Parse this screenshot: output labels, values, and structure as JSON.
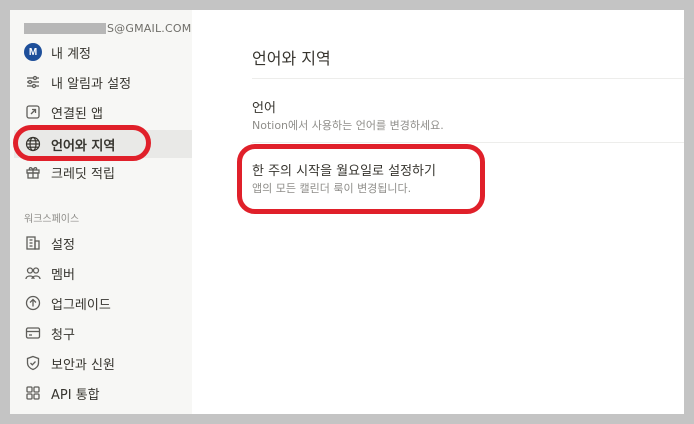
{
  "account": {
    "email_visible": "S@GMAIL.COM"
  },
  "sidebar": {
    "account_items": [
      {
        "label": "내 계정",
        "icon": "avatar",
        "avatar_letter": "M"
      },
      {
        "label": "내 알림과 설정",
        "icon": "sliders-icon"
      },
      {
        "label": "연결된 앱",
        "icon": "external-link-icon"
      },
      {
        "label": "언어와 지역",
        "icon": "globe-icon",
        "active": true
      },
      {
        "label": "크레딧 적립",
        "icon": "gift-icon"
      }
    ],
    "workspace_label": "워크스페이스",
    "workspace_items": [
      {
        "label": "설정",
        "icon": "building-icon"
      },
      {
        "label": "멤버",
        "icon": "members-icon"
      },
      {
        "label": "업그레이드",
        "icon": "upgrade-icon"
      },
      {
        "label": "청구",
        "icon": "credit-card-icon"
      },
      {
        "label": "보안과 신원",
        "icon": "shield-icon"
      },
      {
        "label": "API 통합",
        "icon": "grid-icon"
      }
    ]
  },
  "main": {
    "title": "언어와 지역",
    "settings": [
      {
        "title": "언어",
        "description": "Notion에서 사용하는 언어를 변경하세요."
      },
      {
        "title": "한 주의 시작을 월요일로 설정하기",
        "description": "앱의 모든 캘린더 룩이 변경됩니다."
      }
    ]
  },
  "colors": {
    "highlight": "#e0202a",
    "sidebar_bg": "#f7f7f5",
    "active_bg": "#e9e9e7",
    "avatar": "#1e4f9a"
  }
}
